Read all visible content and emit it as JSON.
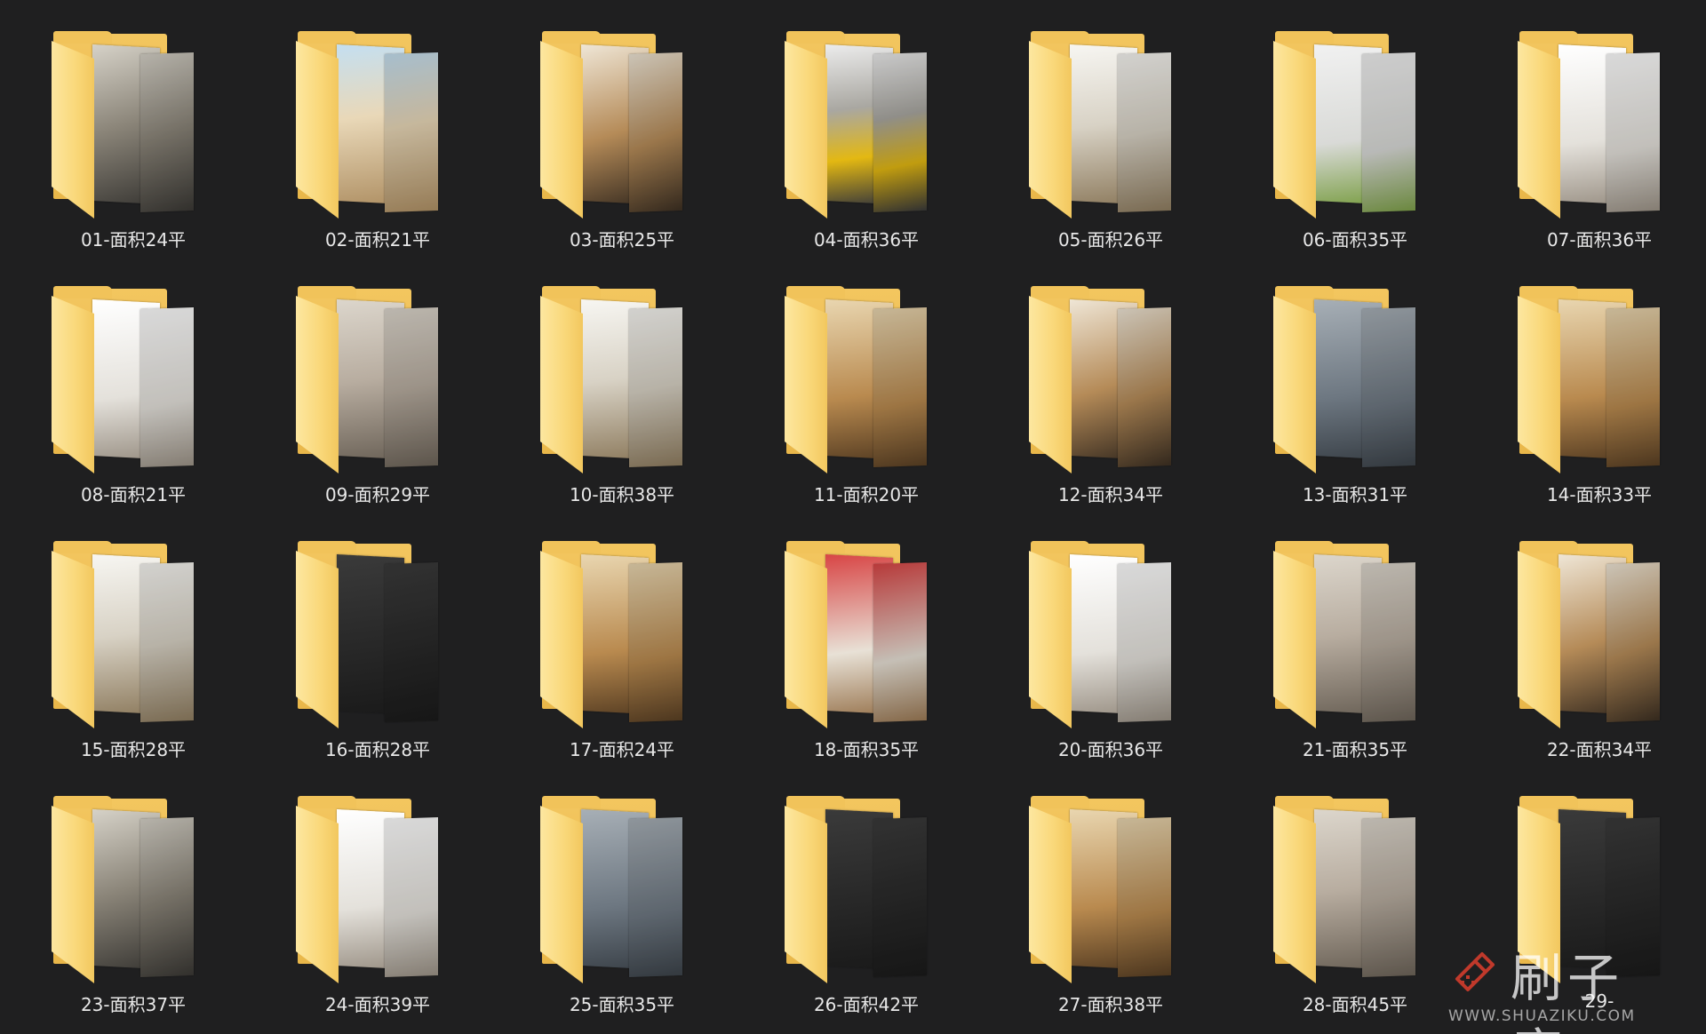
{
  "folders": [
    {
      "label": "01-面积24平",
      "theme": "grey"
    },
    {
      "label": "02-面积21平",
      "theme": "blue"
    },
    {
      "label": "03-面积25平",
      "theme": "warm"
    },
    {
      "label": "04-面积36平",
      "theme": "yellow"
    },
    {
      "label": "05-面积26平",
      "theme": "light"
    },
    {
      "label": "06-面积35平",
      "theme": "green"
    },
    {
      "label": "07-面积36平",
      "theme": "white"
    },
    {
      "label": "08-面积21平",
      "theme": "white"
    },
    {
      "label": "09-面积29平",
      "theme": "stone"
    },
    {
      "label": "10-面积38平",
      "theme": "light"
    },
    {
      "label": "11-面积20平",
      "theme": "wood"
    },
    {
      "label": "12-面积34平",
      "theme": "warm"
    },
    {
      "label": "13-面积31平",
      "theme": "slate"
    },
    {
      "label": "14-面积33平",
      "theme": "wood"
    },
    {
      "label": "15-面积28平",
      "theme": "light"
    },
    {
      "label": "16-面积28平",
      "theme": "dark"
    },
    {
      "label": "17-面积24平",
      "theme": "wood"
    },
    {
      "label": "18-面积35平",
      "theme": "red"
    },
    {
      "label": "20-面积36平",
      "theme": "white"
    },
    {
      "label": "21-面积35平",
      "theme": "stone"
    },
    {
      "label": "22-面积34平",
      "theme": "warm"
    },
    {
      "label": "23-面积37平",
      "theme": "grey"
    },
    {
      "label": "24-面积39平",
      "theme": "white"
    },
    {
      "label": "25-面积35平",
      "theme": "slate"
    },
    {
      "label": "26-面积42平",
      "theme": "dark"
    },
    {
      "label": "27-面积38平",
      "theme": "wood"
    },
    {
      "label": "28-面积45平",
      "theme": "stone"
    },
    {
      "label": "29-",
      "theme": "dark"
    }
  ],
  "theme_colors": {
    "background": "#1f1f20",
    "folder": "#f3c65f",
    "folder_front": "#fde7a0",
    "label": "#e8e8e8"
  },
  "watermark": {
    "title": "刷子库",
    "url": "WWW.SHUAZIKU.COM",
    "icon": "brush-logo-icon",
    "color": "#c0392b"
  }
}
